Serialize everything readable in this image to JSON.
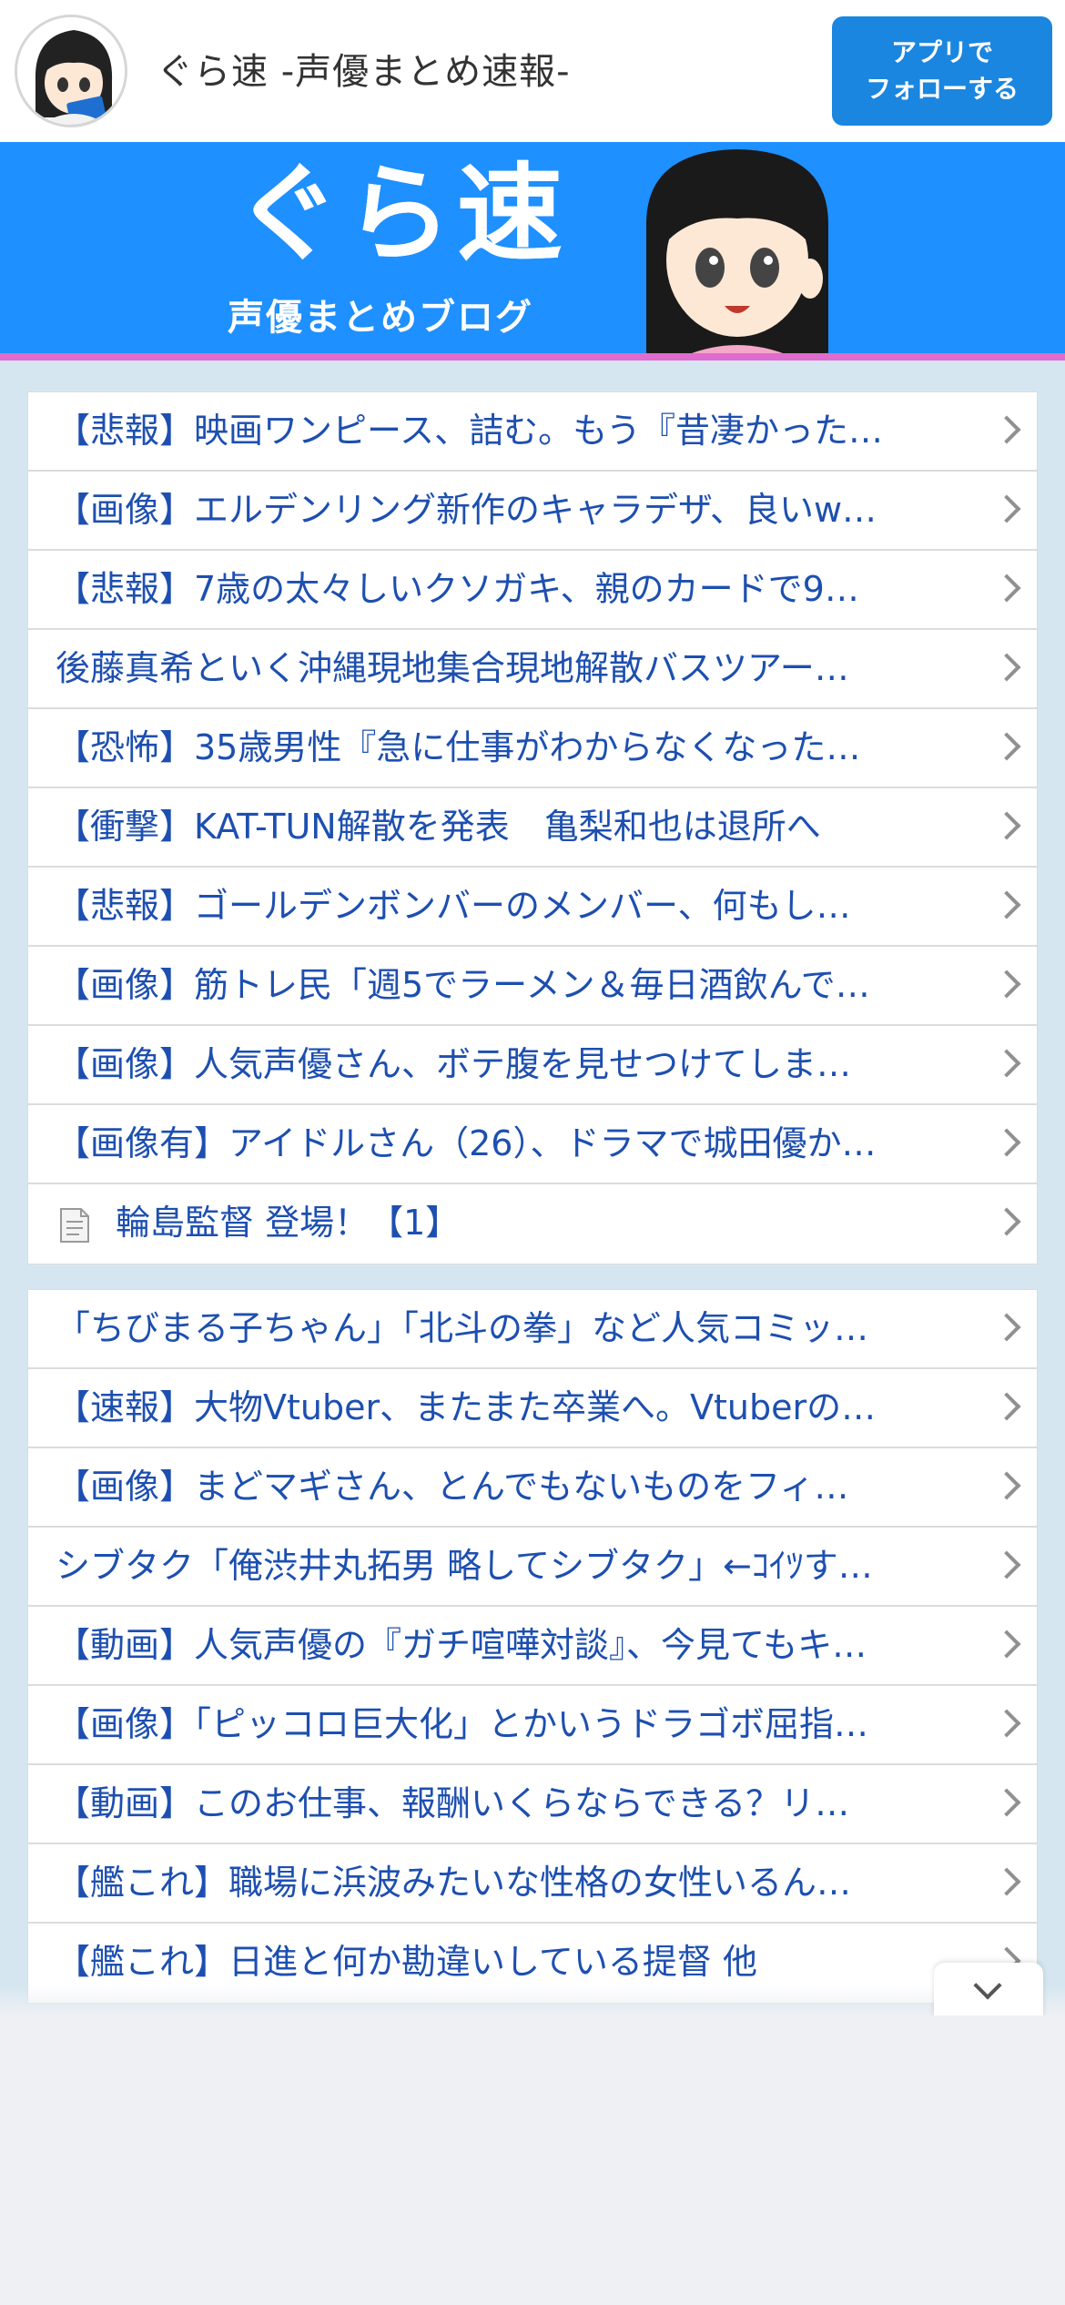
{
  "header": {
    "site_name": "ぐら速 -声優まとめ速報-",
    "follow_button_line1": "アプリで",
    "follow_button_line2": "フォローする"
  },
  "banner": {
    "title": "ぐら速",
    "subtitle": "声優まとめブログ"
  },
  "list_1": [
    {
      "text": "【悲報】映画ワンピース、詰む。もう『昔凄かった…"
    },
    {
      "text": "【画像】エルデンリング新作のキャラデザ、良いw…"
    },
    {
      "text": "【悲報】7歳の太々しいクソガキ、親のカードで9…"
    },
    {
      "text": "後藤真希といく沖縄現地集合現地解散バスツアー…"
    },
    {
      "text": "【恐怖】35歳男性『急に仕事がわからなくなった…"
    },
    {
      "text": "【衝撃】KAT-TUN解散を発表　亀梨和也は退所へ"
    },
    {
      "text": "【悲報】ゴールデンボンバーのメンバー、何もし…"
    },
    {
      "text": "【画像】筋トレ民「週5でラーメン＆毎日酒飲んで…"
    },
    {
      "text": "【画像】人気声優さん、ボテ腹を見せつけてしま…"
    },
    {
      "text": "【画像有】アイドルさん（26）、ドラマで城田優か…"
    },
    {
      "text": "輪島監督 登場！【1】",
      "icon": "document-icon"
    }
  ],
  "list_2": [
    {
      "text": "「ちびまる子ちゃん」「北斗の拳」など人気コミッ…"
    },
    {
      "text": "【速報】大物Vtuber、またまた卒業へ。Vtuberの…"
    },
    {
      "text": "【画像】まどマギさん、とんでもないものをフィ…"
    },
    {
      "text": "シブタク「俺渋井丸拓男 略してシブタク」←ｺｲﾂす…"
    },
    {
      "text": "【動画】人気声優の『ガチ喧嘩対談』、今見てもキ…"
    },
    {
      "text": "【画像】「ピッコロ巨大化」とかいうドラゴボ屈指…"
    },
    {
      "text": "【動画】このお仕事、報酬いくらならできる？リ…"
    },
    {
      "text": "【艦これ】職場に浜波みたいな性格の女性いるん…"
    },
    {
      "text": "【艦これ】日進と何か勘違いしている提督 他"
    }
  ],
  "colors": {
    "link": "#1d4fb0",
    "follow_button": "#1a86e0",
    "banner": "#1e90ff",
    "content_bg": "#d5e6f0"
  }
}
